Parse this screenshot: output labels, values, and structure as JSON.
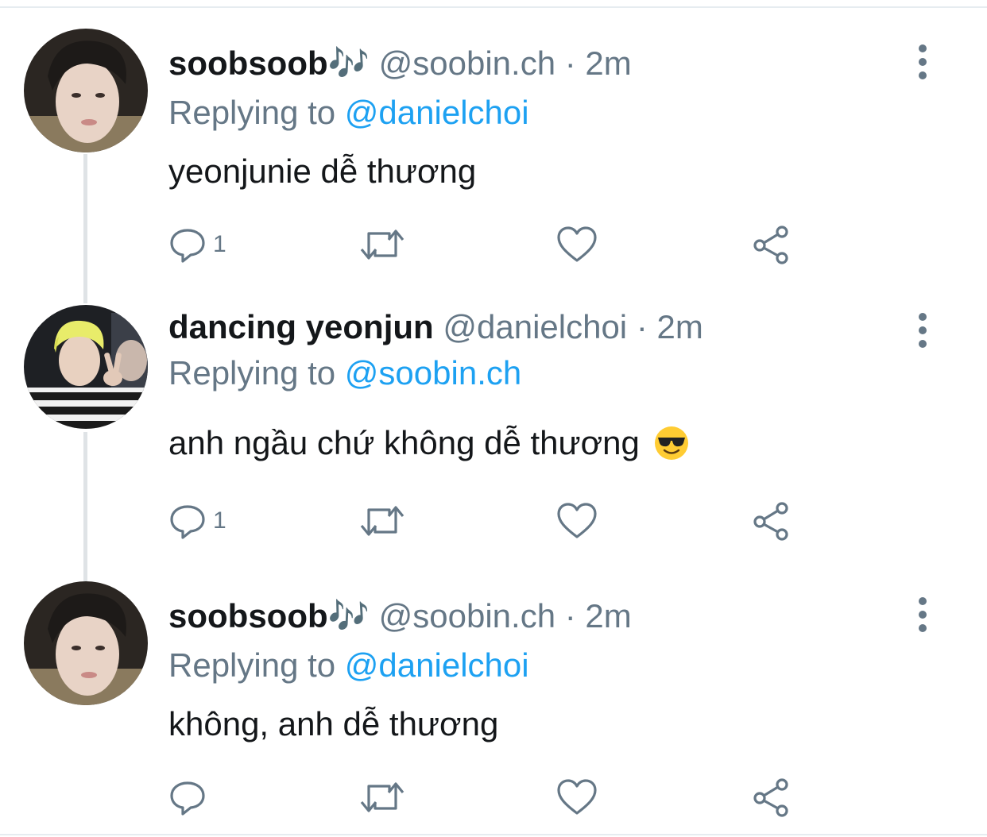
{
  "tweets": [
    {
      "display_name": "soobsoob🎶",
      "handle": "@soobin.ch",
      "separator": "·",
      "time": "2m",
      "replying_prefix": "Replying to",
      "replying_to": "@danielchoi",
      "text": "yeonjunie dễ thương",
      "reply_count": "1",
      "avatar": "profile-photo"
    },
    {
      "display_name": "dancing yeonjun",
      "handle": "@danielchoi",
      "separator": "·",
      "time": "2m",
      "replying_prefix": "Replying to",
      "replying_to": "@soobin.ch",
      "text": "anh ngầu chứ không dễ thương",
      "emoji": "smiling-face-with-sunglasses",
      "reply_count": "1",
      "avatar": "profile-photo-peace-sign"
    },
    {
      "display_name": "soobsoob🎶",
      "handle": "@soobin.ch",
      "separator": "·",
      "time": "2m",
      "replying_prefix": "Replying to",
      "replying_to": "@danielchoi",
      "text": "không, anh dễ thương",
      "reply_count": "",
      "avatar": "profile-photo"
    }
  ],
  "icons": {
    "reply": "speech-bubble-icon",
    "retweet": "retweet-arrows-icon",
    "like": "heart-icon",
    "share": "share-icon",
    "more": "vertical-ellipsis-icon"
  },
  "colors": {
    "accent": "#1da1f2",
    "secondary_text": "#657786",
    "primary_text": "#14171a",
    "thread_line": "#dfe3e6"
  }
}
